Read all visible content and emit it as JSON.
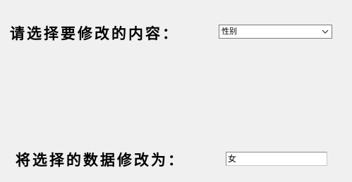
{
  "form": {
    "field_label": "请选择要修改的内容：",
    "field_select": {
      "selected": "性别"
    },
    "value_label": "将选择的数据修改为：",
    "value_input": {
      "value": "女"
    }
  },
  "icons": {
    "dropdown": "chevron-down-icon"
  },
  "colors": {
    "background": "#f0f0f0",
    "control_background": "#ffffff",
    "control_border": "#7a7a7a"
  }
}
